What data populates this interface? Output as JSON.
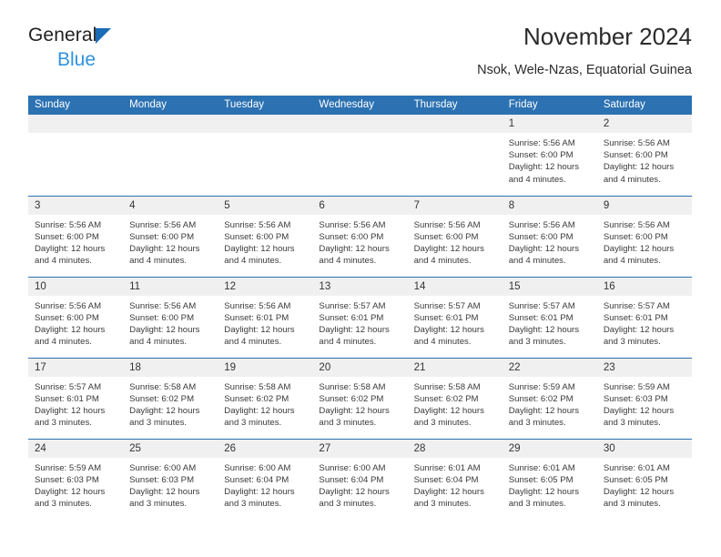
{
  "brand": {
    "name_part1": "General",
    "name_part2": "Blue",
    "logo_icon": "triangle-flag-icon"
  },
  "header": {
    "title": "November 2024",
    "subtitle": "Nsok, Wele-Nzas, Equatorial Guinea"
  },
  "calendar": {
    "weekday_headers": [
      "Sunday",
      "Monday",
      "Tuesday",
      "Wednesday",
      "Thursday",
      "Friday",
      "Saturday"
    ],
    "accent_color": "#2c72b2",
    "daynum_band_color": "#f0f0f0",
    "weeks": [
      [
        {
          "day": "",
          "info": ""
        },
        {
          "day": "",
          "info": ""
        },
        {
          "day": "",
          "info": ""
        },
        {
          "day": "",
          "info": ""
        },
        {
          "day": "",
          "info": ""
        },
        {
          "day": "1",
          "info": "Sunrise: 5:56 AM\nSunset: 6:00 PM\nDaylight: 12 hours\nand 4 minutes."
        },
        {
          "day": "2",
          "info": "Sunrise: 5:56 AM\nSunset: 6:00 PM\nDaylight: 12 hours\nand 4 minutes."
        }
      ],
      [
        {
          "day": "3",
          "info": "Sunrise: 5:56 AM\nSunset: 6:00 PM\nDaylight: 12 hours\nand 4 minutes."
        },
        {
          "day": "4",
          "info": "Sunrise: 5:56 AM\nSunset: 6:00 PM\nDaylight: 12 hours\nand 4 minutes."
        },
        {
          "day": "5",
          "info": "Sunrise: 5:56 AM\nSunset: 6:00 PM\nDaylight: 12 hours\nand 4 minutes."
        },
        {
          "day": "6",
          "info": "Sunrise: 5:56 AM\nSunset: 6:00 PM\nDaylight: 12 hours\nand 4 minutes."
        },
        {
          "day": "7",
          "info": "Sunrise: 5:56 AM\nSunset: 6:00 PM\nDaylight: 12 hours\nand 4 minutes."
        },
        {
          "day": "8",
          "info": "Sunrise: 5:56 AM\nSunset: 6:00 PM\nDaylight: 12 hours\nand 4 minutes."
        },
        {
          "day": "9",
          "info": "Sunrise: 5:56 AM\nSunset: 6:00 PM\nDaylight: 12 hours\nand 4 minutes."
        }
      ],
      [
        {
          "day": "10",
          "info": "Sunrise: 5:56 AM\nSunset: 6:00 PM\nDaylight: 12 hours\nand 4 minutes."
        },
        {
          "day": "11",
          "info": "Sunrise: 5:56 AM\nSunset: 6:00 PM\nDaylight: 12 hours\nand 4 minutes."
        },
        {
          "day": "12",
          "info": "Sunrise: 5:56 AM\nSunset: 6:01 PM\nDaylight: 12 hours\nand 4 minutes."
        },
        {
          "day": "13",
          "info": "Sunrise: 5:57 AM\nSunset: 6:01 PM\nDaylight: 12 hours\nand 4 minutes."
        },
        {
          "day": "14",
          "info": "Sunrise: 5:57 AM\nSunset: 6:01 PM\nDaylight: 12 hours\nand 4 minutes."
        },
        {
          "day": "15",
          "info": "Sunrise: 5:57 AM\nSunset: 6:01 PM\nDaylight: 12 hours\nand 3 minutes."
        },
        {
          "day": "16",
          "info": "Sunrise: 5:57 AM\nSunset: 6:01 PM\nDaylight: 12 hours\nand 3 minutes."
        }
      ],
      [
        {
          "day": "17",
          "info": "Sunrise: 5:57 AM\nSunset: 6:01 PM\nDaylight: 12 hours\nand 3 minutes."
        },
        {
          "day": "18",
          "info": "Sunrise: 5:58 AM\nSunset: 6:02 PM\nDaylight: 12 hours\nand 3 minutes."
        },
        {
          "day": "19",
          "info": "Sunrise: 5:58 AM\nSunset: 6:02 PM\nDaylight: 12 hours\nand 3 minutes."
        },
        {
          "day": "20",
          "info": "Sunrise: 5:58 AM\nSunset: 6:02 PM\nDaylight: 12 hours\nand 3 minutes."
        },
        {
          "day": "21",
          "info": "Sunrise: 5:58 AM\nSunset: 6:02 PM\nDaylight: 12 hours\nand 3 minutes."
        },
        {
          "day": "22",
          "info": "Sunrise: 5:59 AM\nSunset: 6:02 PM\nDaylight: 12 hours\nand 3 minutes."
        },
        {
          "day": "23",
          "info": "Sunrise: 5:59 AM\nSunset: 6:03 PM\nDaylight: 12 hours\nand 3 minutes."
        }
      ],
      [
        {
          "day": "24",
          "info": "Sunrise: 5:59 AM\nSunset: 6:03 PM\nDaylight: 12 hours\nand 3 minutes."
        },
        {
          "day": "25",
          "info": "Sunrise: 6:00 AM\nSunset: 6:03 PM\nDaylight: 12 hours\nand 3 minutes."
        },
        {
          "day": "26",
          "info": "Sunrise: 6:00 AM\nSunset: 6:04 PM\nDaylight: 12 hours\nand 3 minutes."
        },
        {
          "day": "27",
          "info": "Sunrise: 6:00 AM\nSunset: 6:04 PM\nDaylight: 12 hours\nand 3 minutes."
        },
        {
          "day": "28",
          "info": "Sunrise: 6:01 AM\nSunset: 6:04 PM\nDaylight: 12 hours\nand 3 minutes."
        },
        {
          "day": "29",
          "info": "Sunrise: 6:01 AM\nSunset: 6:05 PM\nDaylight: 12 hours\nand 3 minutes."
        },
        {
          "day": "30",
          "info": "Sunrise: 6:01 AM\nSunset: 6:05 PM\nDaylight: 12 hours\nand 3 minutes."
        }
      ]
    ]
  }
}
